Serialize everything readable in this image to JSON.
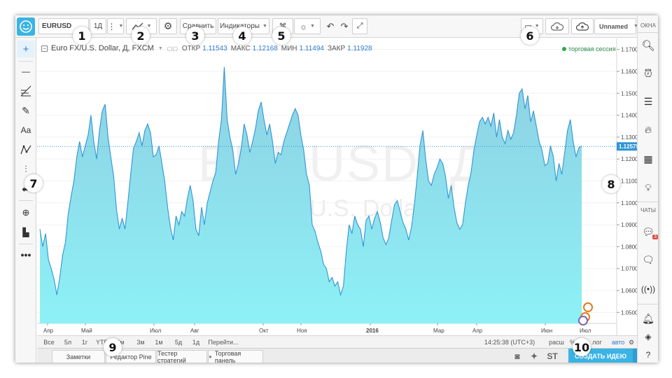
{
  "toolbar": {
    "symbol": "EURUSD",
    "interval": "1Д",
    "compare": "Сравнить",
    "indicators": "Индикаторы",
    "layout_name": "Unnamed"
  },
  "legend": {
    "title": "Euro FX/U.S. Dollar, Д, FXCM",
    "open_label": "ОТКР",
    "open": "1.11543",
    "high_label": "МАКС",
    "high": "1.12168",
    "low_label": "МИН",
    "low": "1.11494",
    "close_label": "ЗАКР",
    "close": "1.11928"
  },
  "session_status": "торговая сессия",
  "watermark": {
    "symbol": "EURUSD, Д",
    "description": "Euro FX/U.S. Dollar"
  },
  "right_panel": {
    "watchlist_label": "ОКНА",
    "chats_label": "ЧАТЫ",
    "chat_badge": "3"
  },
  "chart_data": {
    "type": "area",
    "series": [
      {
        "values": [
          1.088,
          1.08,
          1.086,
          1.074,
          1.07,
          1.065,
          1.058,
          1.066,
          1.076,
          1.082,
          1.095,
          1.103,
          1.11,
          1.121,
          1.128,
          1.121,
          1.126,
          1.131,
          1.14,
          1.128,
          1.12,
          1.133,
          1.142,
          1.145,
          1.13,
          1.121,
          1.112,
          1.097,
          1.088,
          1.093,
          1.088,
          1.1,
          1.113,
          1.125,
          1.128,
          1.132,
          1.126,
          1.133,
          1.136,
          1.132,
          1.121,
          1.122,
          1.126,
          1.118,
          1.11,
          1.098,
          1.089,
          1.083,
          1.094,
          1.09,
          1.096,
          1.094,
          1.102,
          1.108,
          1.101,
          1.088,
          1.085,
          1.098,
          1.09,
          1.1,
          1.105,
          1.11,
          1.114,
          1.128,
          1.138,
          1.162,
          1.138,
          1.13,
          1.124,
          1.113,
          1.118,
          1.125,
          1.136,
          1.131,
          1.123,
          1.128,
          1.134,
          1.142,
          1.146,
          1.138,
          1.131,
          1.136,
          1.128,
          1.118,
          1.123,
          1.122,
          1.128,
          1.132,
          1.136,
          1.14,
          1.143,
          1.14,
          1.131,
          1.124,
          1.113,
          1.108,
          1.09,
          1.087,
          1.082,
          1.078,
          1.072,
          1.07,
          1.064,
          1.066,
          1.062,
          1.064,
          1.058,
          1.062,
          1.078,
          1.09,
          1.086,
          1.094,
          1.09,
          1.088,
          1.08,
          1.092,
          1.094,
          1.088,
          1.093,
          1.096,
          1.091,
          1.084,
          1.081,
          1.084,
          1.092,
          1.099,
          1.101,
          1.096,
          1.091,
          1.088,
          1.083,
          1.089,
          1.099,
          1.112,
          1.126,
          1.133,
          1.12,
          1.11,
          1.108,
          1.113,
          1.116,
          1.12,
          1.118,
          1.112,
          1.102,
          1.108,
          1.098,
          1.091,
          1.088,
          1.09,
          1.1,
          1.108,
          1.114,
          1.124,
          1.131,
          1.137,
          1.139,
          1.136,
          1.139,
          1.135,
          1.141,
          1.13,
          1.138,
          1.13,
          1.127,
          1.133,
          1.129,
          1.132,
          1.14,
          1.15,
          1.152,
          1.143,
          1.149,
          1.137,
          1.142,
          1.135,
          1.128,
          1.124,
          1.117,
          1.118,
          1.126,
          1.121,
          1.11,
          1.118,
          1.113,
          1.123,
          1.133,
          1.138,
          1.128,
          1.121,
          1.125,
          1.126
        ]
      }
    ],
    "x_labels": [
      "Апр",
      "Май",
      "Июл",
      "Авг",
      "Окт",
      "Ноя",
      "2016",
      "Мар",
      "Апр",
      "Июн",
      "Июл"
    ],
    "y_ticks": [
      "1.17000",
      "1.16000",
      "1.15000",
      "1.14000",
      "1.13000",
      "1.12000",
      "1.11000",
      "1.10000",
      "1.09000",
      "1.08000",
      "1.07000",
      "1.06000",
      "1.05000"
    ],
    "ylim": [
      1.045,
      1.175
    ],
    "last_price": "1.12575",
    "last_value": 1.12575,
    "grid": true,
    "colors": {
      "line": "#2f96d6",
      "fill_top": "#8fcfe2",
      "fill_bottom": "#8df1f6",
      "price_tag": "#2f96d6"
    }
  },
  "range_bar": {
    "items": [
      "Все",
      "5л",
      "1г",
      "YTD",
      "6м",
      "3м",
      "1м",
      "5д",
      "1д",
      "Перейти..."
    ],
    "timestamp": "14:25:38 (UTC+3)",
    "scale_options": [
      "расш",
      "%",
      "лог",
      "авто"
    ]
  },
  "bottom_tabs": {
    "tabs": [
      "Заметки",
      "Редактор Pine",
      "Тестер стратегий",
      "Торговая панель"
    ],
    "st_label": "ST",
    "publish": "СОЗДАТЬ ИДЕЮ"
  },
  "callouts": [
    "1",
    "2",
    "3",
    "4",
    "5",
    "6",
    "7",
    "8",
    "9",
    "10"
  ]
}
